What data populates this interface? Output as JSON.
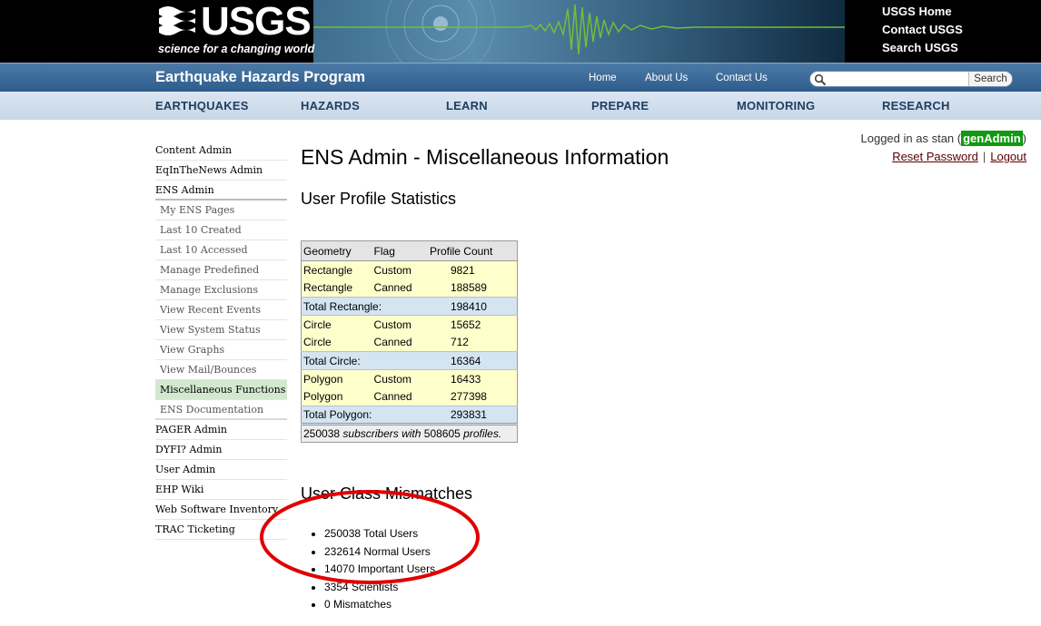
{
  "banner": {
    "logo_text": "USGS",
    "tagline": "science for a changing world",
    "links": [
      "USGS Home",
      "Contact USGS",
      "Search USGS"
    ]
  },
  "program_bar": {
    "title": "Earthquake Hazards Program",
    "nav": [
      "Home",
      "About Us",
      "Contact Us"
    ],
    "search": {
      "value": "",
      "placeholder": "",
      "button_label": "Search"
    }
  },
  "main_nav": [
    "EARTHQUAKES",
    "HAZARDS",
    "LEARN",
    "PREPARE",
    "MONITORING",
    "RESEARCH"
  ],
  "sidebar": {
    "items": [
      {
        "label": "Content Admin"
      },
      {
        "label": "EqInTheNews Admin"
      },
      {
        "label": "ENS Admin"
      },
      {
        "label": "My ENS Pages"
      },
      {
        "label": "Last 10 Created"
      },
      {
        "label": "Last 10 Accessed"
      },
      {
        "label": "Manage Predefined"
      },
      {
        "label": "Manage Exclusions"
      },
      {
        "label": "View Recent Events"
      },
      {
        "label": "View System Status"
      },
      {
        "label": "View Graphs"
      },
      {
        "label": "View Mail/Bounces"
      },
      {
        "label": "Miscellaneous Functions"
      },
      {
        "label": "ENS Documentation"
      },
      {
        "label": "PAGER Admin"
      },
      {
        "label": "DYFI? Admin"
      },
      {
        "label": "User Admin"
      },
      {
        "label": "EHP Wiki"
      },
      {
        "label": "Web Software Inventory"
      },
      {
        "label": "TRAC Ticketing"
      }
    ]
  },
  "login": {
    "prefix": "Logged in as stan (",
    "role": "genAdmin",
    "suffix": ")",
    "reset_label": "Reset Password",
    "separator": "|",
    "logout_label": "Logout"
  },
  "page": {
    "title": "ENS Admin - Miscellaneous Information",
    "profile_heading": "User Profile Statistics",
    "mismatch_heading": "User Class Mismatches"
  },
  "stats_table": {
    "headers": [
      "Geometry",
      "Flag",
      "Profile Count"
    ],
    "groups": [
      {
        "rows": [
          {
            "geometry": "Rectangle",
            "flag": "Custom",
            "count": "9821"
          },
          {
            "geometry": "Rectangle",
            "flag": "Canned",
            "count": "188589"
          }
        ],
        "total_label": "Total Rectangle:",
        "total": "198410"
      },
      {
        "rows": [
          {
            "geometry": "Circle",
            "flag": "Custom",
            "count": "15652"
          },
          {
            "geometry": "Circle",
            "flag": "Canned",
            "count": "712"
          }
        ],
        "total_label": "Total Circle:",
        "total": "16364"
      },
      {
        "rows": [
          {
            "geometry": "Polygon",
            "flag": "Custom",
            "count": "16433"
          },
          {
            "geometry": "Polygon",
            "flag": "Canned",
            "count": "277398"
          }
        ],
        "total_label": "Total Polygon:",
        "total": "293831"
      }
    ],
    "footer": {
      "subscribers": "250038",
      "subscribers_label": "subscribers with",
      "profiles": "508605",
      "profiles_label": "profiles."
    }
  },
  "mismatches": [
    "250038 Total Users",
    "232614 Normal Users",
    "14070 Important Users",
    "3354 Scientists",
    "0 Mismatches"
  ],
  "colors": {
    "program_bar": "#2e5c8c",
    "nav_bar": "#c6d6e8",
    "active_sidebar": "#d3e9cf",
    "role_badge": "#119911",
    "table_row": "#ffffcc",
    "table_total": "#d4e4f1",
    "annotation": "#e00000"
  }
}
